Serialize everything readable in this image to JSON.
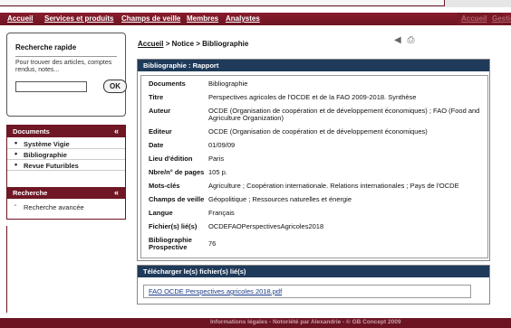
{
  "topnav": {
    "items": [
      "Accueil",
      "Services et produits",
      "Champs de veille",
      "Membres",
      "Analystes"
    ],
    "right_items": [
      "Accueil",
      "Gestion"
    ]
  },
  "quick_search": {
    "title": "Recherche rapide",
    "description": "Pour trouver des articles, comptes rendus, notes...",
    "input_value": "",
    "ok_label": "OK"
  },
  "menu": {
    "documents_title": "Documents",
    "documents_items": [
      "Système Vigie",
      "Bibliographie",
      "Revue Futuribles"
    ],
    "recherche_title": "Recherche",
    "recherche_items": [
      "Recherche avancée"
    ],
    "chevron": "«"
  },
  "breadcrumb": {
    "home": "Accueil",
    "rest": " > Notice > Bibliographie"
  },
  "icons": {
    "back": "back-arrow-icon",
    "print": "print-icon"
  },
  "report": {
    "title": "Bibliographie : Rapport",
    "fields": [
      {
        "label": "Documents",
        "value": "Bibliographie"
      },
      {
        "label": "Titre",
        "value": "Perspectives agricoles de l'OCDE et de la FAO 2009-2018. Synthèse"
      },
      {
        "label": "Auteur",
        "value": "OCDE (Organisation de coopération et de développement économiques) ; FAO (Food and Agriculture Organization)"
      },
      {
        "label": "Editeur",
        "value": "OCDE (Organisation de coopération et de développement économiques)"
      },
      {
        "label": "Date",
        "value": "01/09/09"
      },
      {
        "label": "Lieu d'édition",
        "value": "Paris"
      },
      {
        "label": "Nbre/n° de pages",
        "value": "105 p."
      },
      {
        "label": "Mots-clés",
        "value": "Agriculture ; Coopération internationale. Relations internationales ; Pays de l'OCDE"
      },
      {
        "label": "Champs de veille",
        "value": "Géopolitique ; Ressources naturelles et énergie"
      },
      {
        "label": "Langue",
        "value": "Français"
      },
      {
        "label": "Fichier(s) lié(s)",
        "value": "OCDEFAOPerspectivesAgricoles2018"
      },
      {
        "label": "Bibliographie Prospective",
        "value": "76"
      }
    ]
  },
  "download": {
    "title": "Télécharger le(s) fichier(s) lié(s)",
    "file": "FAO OCDE Perspectives agricoles 2018.pdf"
  },
  "footer": {
    "text": "Informations légales - Notoriété par Alexandrie - © GB Concept 2009"
  }
}
